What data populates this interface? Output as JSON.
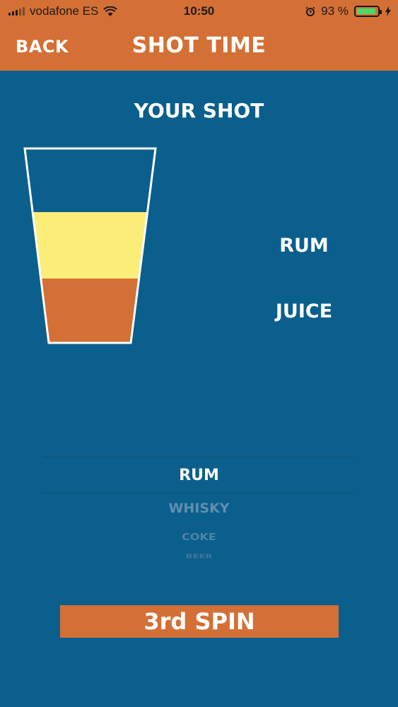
{
  "status_bar": {
    "carrier": "vodafone ES",
    "time": "10:50",
    "battery_percent": "93 %",
    "battery_level": 0.93,
    "icons": [
      "signal-icon",
      "wifi-icon",
      "alarm-icon",
      "battery-icon",
      "charging-icon"
    ]
  },
  "nav": {
    "back_label": "BACK",
    "title": "SHOT TIME"
  },
  "shot": {
    "heading": "YOUR SHOT",
    "layers": [
      {
        "label": "RUM",
        "color": "#fbee78"
      },
      {
        "label": "JUICE",
        "color": "#d47035"
      }
    ],
    "empty_color": "#0b5f8c",
    "glass_outline_color": "#ffffff"
  },
  "picker": {
    "items": [
      "RUM",
      "WHISKY",
      "COKE",
      "BEER"
    ],
    "selected_index": 0
  },
  "spin_button": {
    "label": "3rd SPIN"
  },
  "colors": {
    "accent": "#d47035",
    "background": "#0b5f8c"
  }
}
